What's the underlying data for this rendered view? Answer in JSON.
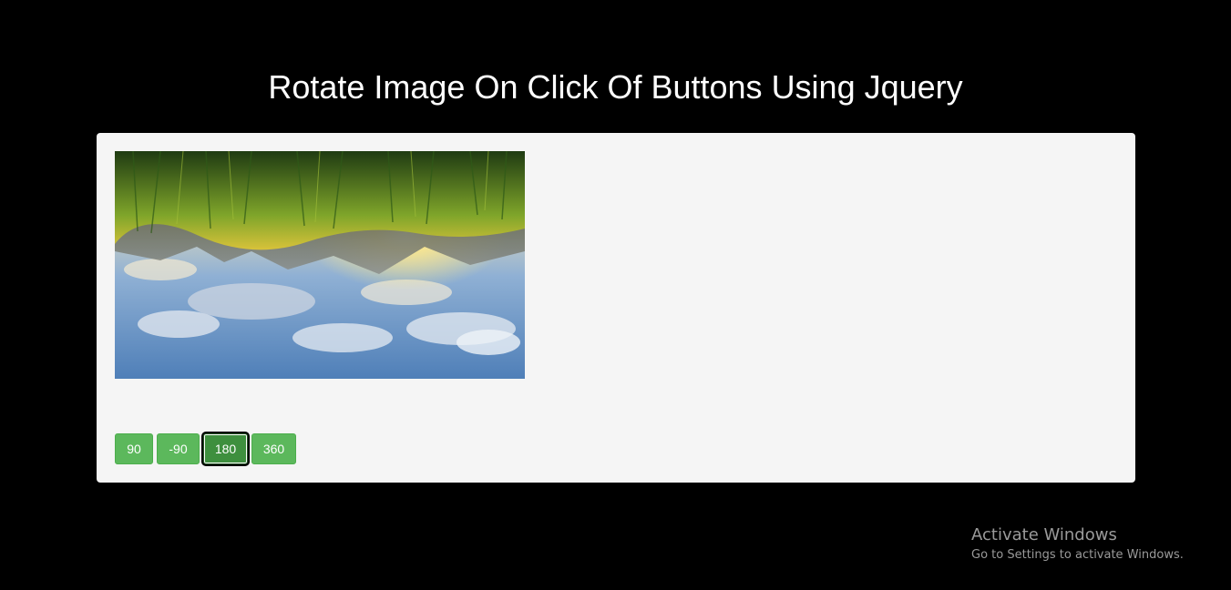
{
  "header": {
    "title": "Rotate Image On Click Of Buttons Using Jquery"
  },
  "image": {
    "subject": "sunset landscape with grass and clouds",
    "rotation_degrees": 180
  },
  "buttons": [
    {
      "label": "90"
    },
    {
      "label": "-90"
    },
    {
      "label": "180",
      "active": true
    },
    {
      "label": "360"
    }
  ],
  "watermark": {
    "title": "Activate Windows",
    "subtitle": "Go to Settings to activate Windows."
  },
  "colors": {
    "background": "#000000",
    "panel": "#f5f5f5",
    "button": "#5cb85c",
    "button_active": "#3e8f3e"
  }
}
